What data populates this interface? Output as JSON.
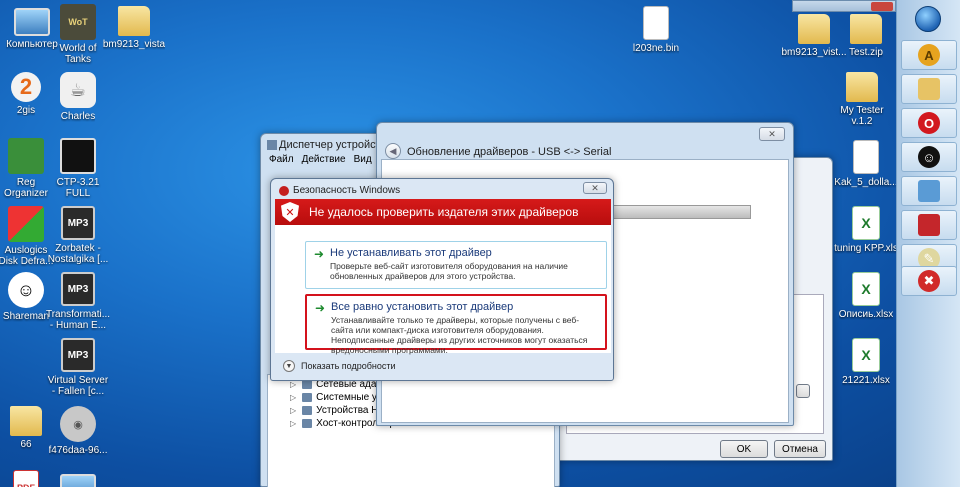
{
  "desktop": {
    "icons": [
      {
        "label": "Компьютер",
        "icon": "computer-icon"
      },
      {
        "label": "World of Tanks",
        "icon": "tank-icon"
      },
      {
        "label": "bm9213_vista",
        "icon": "folder-icon"
      },
      {
        "label": "2gis",
        "icon": "2gis-icon"
      },
      {
        "label": "Charles",
        "icon": "jug-icon"
      },
      {
        "label": "Reg Organizer",
        "icon": "reg-organizer-icon"
      },
      {
        "label": "CTP-3.21 FULL",
        "icon": "ctp-icon"
      },
      {
        "label": "Auslogics Disk Defra...",
        "icon": "auslogics-icon"
      },
      {
        "label": "Zorbatek - Nostalgika [...",
        "icon": "mp3-icon"
      },
      {
        "label": "Shareman",
        "icon": "shareman-icon"
      },
      {
        "label": "Transformati... - Human E...",
        "icon": "mp3-icon"
      },
      {
        "label": "Virtual Server - Fallen [c...",
        "icon": "mp3-icon"
      },
      {
        "label": "66",
        "icon": "folder-icon"
      },
      {
        "label": "f476daa-96...",
        "icon": "disk-icon"
      },
      {
        "label": "l203ne.bin",
        "icon": "file-icon"
      },
      {
        "label": "bm9213_vist...",
        "icon": "folder-icon"
      },
      {
        "label": "Test.zip",
        "icon": "zip-folder-icon"
      },
      {
        "label": "My Tester v.1.2",
        "icon": "folder-icon"
      },
      {
        "label": "Kak_5_dolla...",
        "icon": "file-icon"
      },
      {
        "label": "tuning KPP.xls",
        "icon": "excel-icon"
      },
      {
        "label": "Описиь.xlsx",
        "icon": "excel-icon"
      },
      {
        "label": "21221.xlsx",
        "icon": "excel-icon"
      },
      {
        "label": "PDF",
        "icon": "pdf-icon"
      }
    ],
    "mp3_badge": "MP3",
    "pdf_badge": "PDF"
  },
  "device_manager": {
    "title": "Диспетчер устройств",
    "menu": [
      "Файл",
      "Действие",
      "Вид",
      "С"
    ],
    "tree": [
      "Сетевые адаптеры",
      "Системные устрой",
      "Устройства HID (Hu",
      "Хост-контроллеры"
    ]
  },
  "back_dialog": {
    "ok": "OK",
    "cancel": "Отмена"
  },
  "wizard": {
    "title": "Обновление драйверов - USB <-> Serial"
  },
  "security": {
    "title": "Безопасность Windows",
    "banner": "Не удалось проверить издателя этих драйверов",
    "option1_title": "Не устанавливать этот драйвер",
    "option1_desc": "Проверьте веб-сайт изготовителя оборудования на наличие обновленных драйверов для этого устройства.",
    "option2_title": "Все равно установить этот драйвер",
    "option2_desc": "Устанавливайте только те драйверы, которые получены с веб-сайта или компакт-диска изготовителя оборудования. Неподписанные драйверы из других источников могут оказаться вредоносными программами.",
    "details": "Показать подробности"
  },
  "colors": {
    "banner_red": "#c41212",
    "highlight_red": "#d4121c",
    "desktop_blue": "#1a71c9"
  }
}
